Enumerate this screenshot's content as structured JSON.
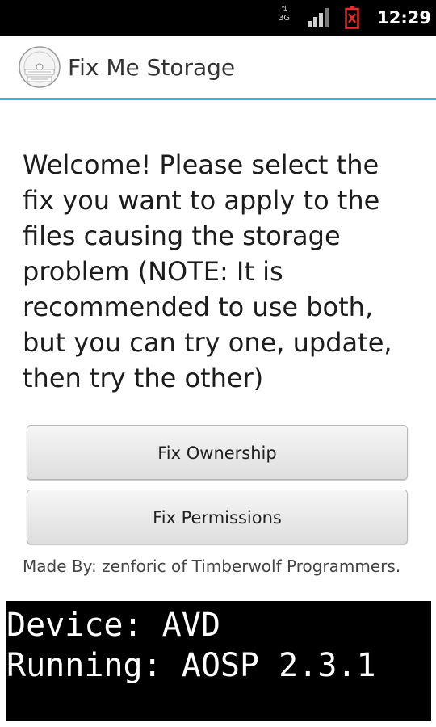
{
  "status_bar": {
    "network_type": "3G",
    "signal_icon": "signal-bars-icon",
    "battery_icon": "battery-empty-icon",
    "battery_color": "#e03030",
    "time": "12:29"
  },
  "action_bar": {
    "logo_icon": "app-logo-icon",
    "title": "Fix Me Storage",
    "divider_color": "#33b5e5"
  },
  "main": {
    "welcome_text": "Welcome! Please select the fix you want to apply to the files causing the storage problem (NOTE: It is recommended to use both, but you can try one, update, then try the other)",
    "buttons": {
      "fix_ownership": "Fix Ownership",
      "fix_permissions": "Fix Permissions"
    },
    "credit": "Made By: zenforic of Timberwolf Programmers."
  },
  "terminal": {
    "line1": "Device: AVD",
    "line2": "Running: AOSP 2.3.1"
  }
}
